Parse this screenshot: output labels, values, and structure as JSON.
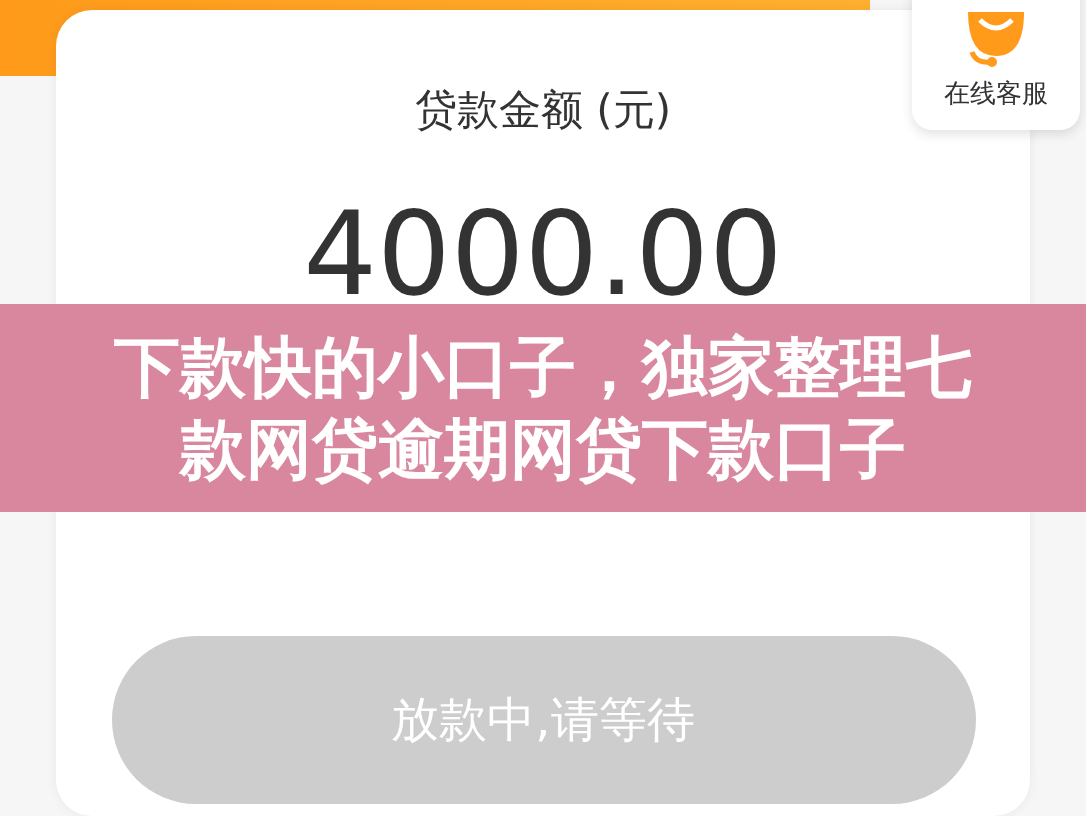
{
  "card": {
    "label": "贷款金额 (元)",
    "amount": "4000.00",
    "button": {
      "label": "放款中,请等待",
      "disabled": true
    }
  },
  "service_widget": {
    "label": "在线客服"
  },
  "overlay_title": {
    "lines": [
      "下款快的小口子，独家整理七",
      "款网贷逾期网贷下款口子"
    ]
  }
}
